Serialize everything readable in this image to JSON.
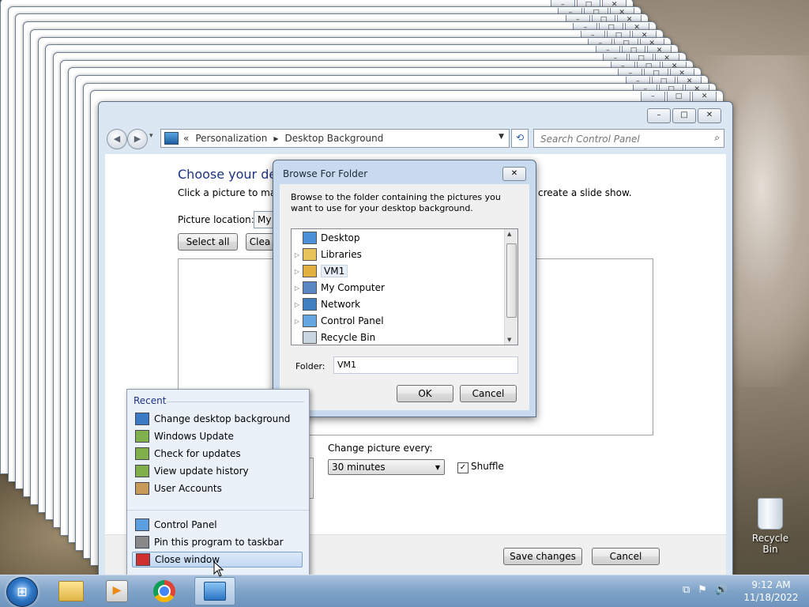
{
  "desktop": {
    "stack_button_glyphs": [
      "–",
      "□",
      "✕"
    ]
  },
  "main_window": {
    "buttons": {
      "minimize": "–",
      "maximize": "□",
      "close": "✕"
    },
    "nav": {
      "back_glyph": "◀",
      "forward_glyph": "▶",
      "recent_glyph": "▾"
    },
    "address": {
      "chevrons": "«",
      "crumbs": [
        "Personalization",
        "Desktop Background"
      ],
      "separator": "▶",
      "dropdown_glyph": "▼",
      "refresh_glyph": "⟲"
    },
    "search": {
      "placeholder": "Search Control Panel",
      "icon_glyph": "⌕"
    },
    "heading": "Choose your desktop background",
    "description_start": "Click a picture to make it your desktop background, or select more than one picture to create a slide show.",
    "description_end": "create a slide show.",
    "picture_location_label": "Picture location:",
    "picture_location_value": "My",
    "select_all": "Select all",
    "clear_all": "Clea",
    "change_picture_label": "Change picture every:",
    "interval_value": "30 minutes",
    "interval_arrow": "▼",
    "shuffle_label": "Shuffle",
    "shuffle_checked": "✓",
    "save_changes": "Save changes",
    "cancel": "Cancel"
  },
  "dialog": {
    "title": "Browse For Folder",
    "close_glyph": "✕",
    "instructions": "Browse to the folder containing the pictures you want to use for your desktop background.",
    "tree": [
      {
        "label": "Desktop",
        "expander": "",
        "icon_color": "#4a8fd8"
      },
      {
        "label": "Libraries",
        "expander": "▷",
        "icon_color": "#e8c25a"
      },
      {
        "label": "VM1",
        "expander": "▷",
        "icon_color": "#e2b040"
      },
      {
        "label": "My Computer",
        "expander": "▷",
        "icon_color": "#5b86c4"
      },
      {
        "label": "Network",
        "expander": "▷",
        "icon_color": "#3f7fc0"
      },
      {
        "label": "Control Panel",
        "expander": "▷",
        "icon_color": "#64a6e0"
      },
      {
        "label": "Recycle Bin",
        "expander": "",
        "icon_color": "#c9d6e2"
      }
    ],
    "scroll_up": "▲",
    "scroll_down": "▼",
    "folder_label": "Folder:",
    "folder_value": "VM1",
    "ok": "OK",
    "cancel": "Cancel"
  },
  "jumplist": {
    "heading": "Recent",
    "recent": [
      {
        "label": "Change desktop background",
        "icon_color": "#3b7ac4"
      },
      {
        "label": "Windows Update",
        "icon_color": "#7fb04a"
      },
      {
        "label": "Check for updates",
        "icon_color": "#7fb04a"
      },
      {
        "label": "View update history",
        "icon_color": "#7fb04a"
      },
      {
        "label": "User Accounts",
        "icon_color": "#c89a5a"
      }
    ],
    "tasks": [
      {
        "label": "Control Panel",
        "icon_color": "#5a9ee0"
      },
      {
        "label": "Pin this program to taskbar",
        "icon_color": "#888888"
      },
      {
        "label": "Close window",
        "icon_color": "#d03030"
      }
    ]
  },
  "recycle_bin": {
    "label": "Recycle Bin"
  },
  "taskbar": {
    "start_glyph": "⊞",
    "media_glyph": "▶",
    "tray_icons": [
      "⧉",
      "⚑",
      "🔊"
    ],
    "time": "9:12 AM",
    "date": "11/18/2022"
  }
}
